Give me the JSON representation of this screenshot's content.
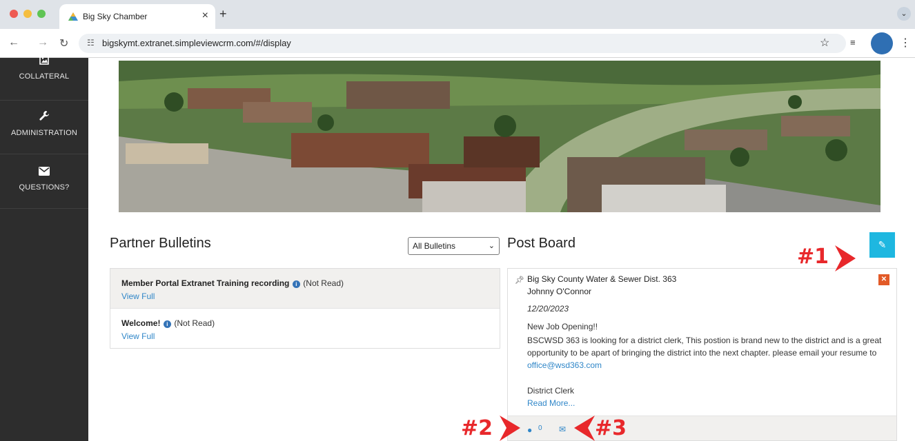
{
  "browser": {
    "tab_title": "Big Sky Chamber",
    "tab_close": "×",
    "new_tab": "+",
    "url": "bigskymt.extranet.simpleviewcrm.com/#/display",
    "menu_chevron": "⌄"
  },
  "sidebar": {
    "items": [
      {
        "label": "COLLATERAL",
        "icon": "image-icon"
      },
      {
        "label": "ADMINISTRATION",
        "icon": "wrench-icon"
      },
      {
        "label": "QUESTIONS?",
        "icon": "envelope-icon"
      }
    ]
  },
  "partner_bulletins": {
    "title": "Partner Bulletins",
    "filter_selected": "All Bulletins",
    "items": [
      {
        "title": "Member Portal Extranet Training recording",
        "status": "(Not Read)",
        "link": "View Full"
      },
      {
        "title": "Welcome!",
        "status": "(Not Read)",
        "link": "View Full"
      }
    ]
  },
  "post_board": {
    "title": "Post Board",
    "post": {
      "organization": "Big Sky County Water & Sewer Dist. 363",
      "author": "Johnny O'Connor",
      "date": "12/20/2023",
      "heading": "New Job Opening!!",
      "body": "BSCWSD 363 is looking for a district clerk, This postion is brand new to the district and is a great opportunity to be apart of bringing the district into the next chapter. please email your resume to ",
      "email": "office@wsd363.com",
      "role": "District Clerk",
      "read_more": "Read More...",
      "comment_count": "0"
    }
  },
  "annotations": {
    "a1": "#1",
    "a2": "#2",
    "a3": "#3"
  },
  "colors": {
    "accent": "#1eb7e0",
    "link": "#2f86c8",
    "delete": "#e25a27",
    "annotation": "#e8282b",
    "sidebar": "#2d2d2d"
  }
}
